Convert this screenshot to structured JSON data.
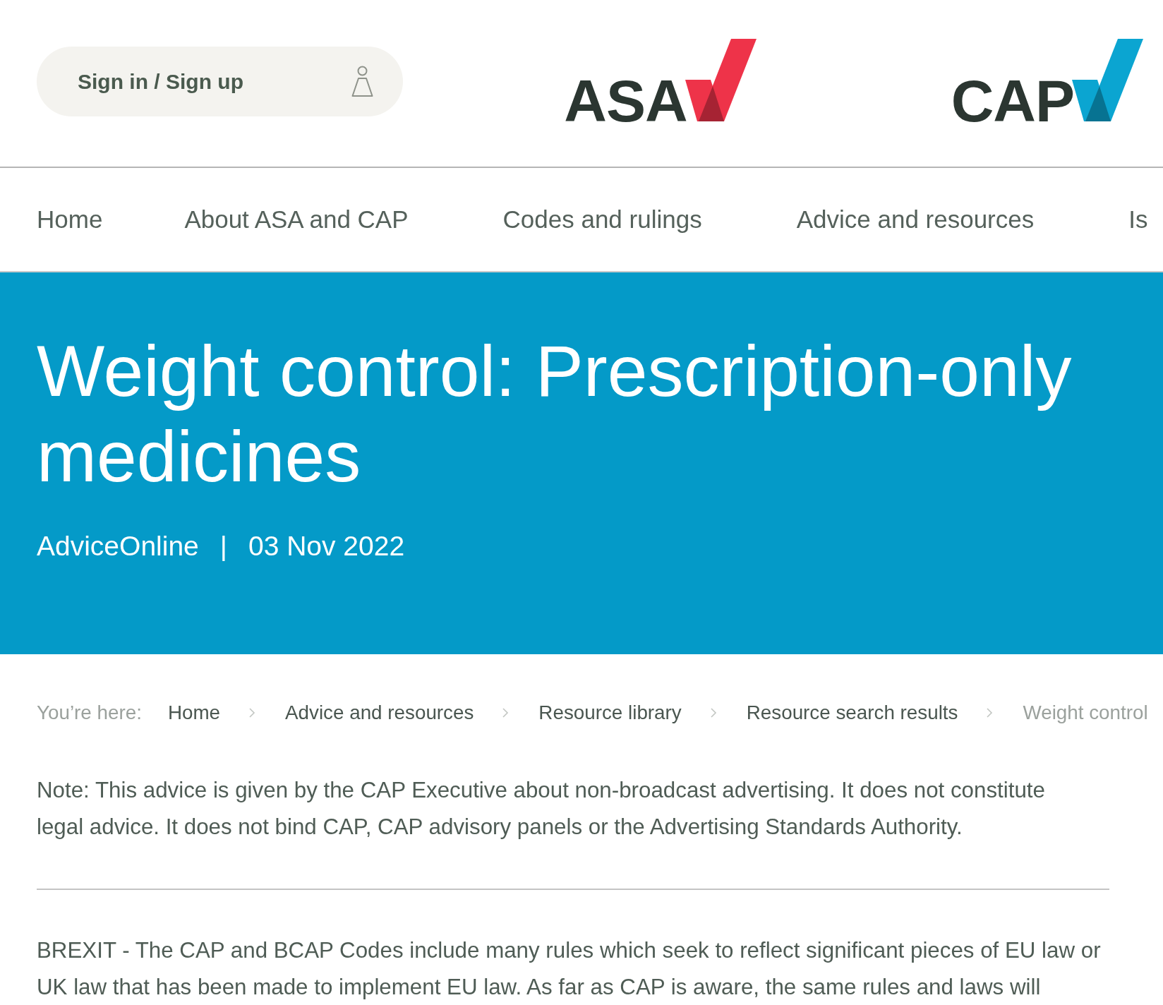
{
  "header": {
    "sign_in": {
      "label": "Sign in / Sign up"
    },
    "logos": [
      {
        "text": "ASA",
        "color": "#ee3349"
      },
      {
        "text": "CAP",
        "color": "#0ba5d1"
      }
    ]
  },
  "nav": {
    "items": [
      "Home",
      "About ASA and CAP",
      "Codes and rulings",
      "Advice and resources",
      "Is"
    ]
  },
  "hero": {
    "title": "Weight control: Prescription-only medicines",
    "category": "AdviceOnline",
    "separator": "|",
    "date": "03 Nov 2022"
  },
  "breadcrumb": {
    "label": "You’re here:",
    "items": [
      {
        "label": "Home",
        "current": false
      },
      {
        "label": "Advice and resources",
        "current": false
      },
      {
        "label": "Resource library",
        "current": false
      },
      {
        "label": "Resource search results",
        "current": false
      },
      {
        "label": "Weight control",
        "current": true
      }
    ]
  },
  "article": {
    "note": "Note: This advice is given by the CAP Executive about non-broadcast advertising. It does not constitute legal advice. It does not bind CAP, CAP advisory panels or the Advertising Standards Authority.",
    "paragraphs": [
      "BREXIT - The CAP and BCAP Codes include many rules which seek to reflect significant pieces of EU law or UK law that has been made to implement EU law. As far as CAP is aware, the same rules and laws will"
    ]
  }
}
